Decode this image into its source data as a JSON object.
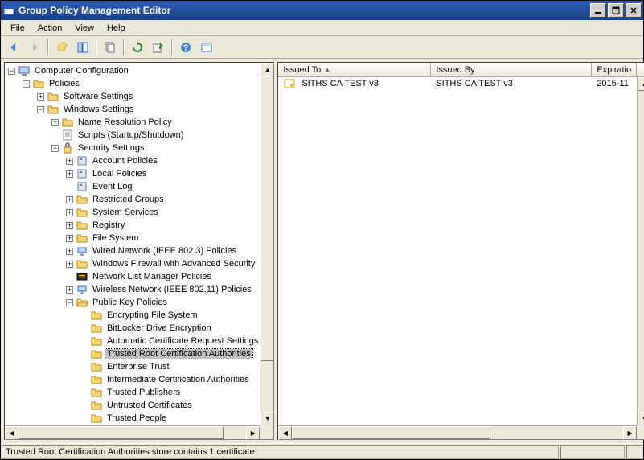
{
  "window": {
    "title": "Group Policy Management Editor"
  },
  "menu": {
    "file": "File",
    "action": "Action",
    "view": "View",
    "help": "Help"
  },
  "tree": {
    "root": "Computer Configuration",
    "policies": "Policies",
    "software": "Software Settings",
    "windows": "Windows Settings",
    "nrp": "Name Resolution Policy",
    "scripts": "Scripts (Startup/Shutdown)",
    "security": "Security Settings",
    "account": "Account Policies",
    "local": "Local Policies",
    "eventlog": "Event Log",
    "restricted": "Restricted Groups",
    "services": "System Services",
    "registry": "Registry",
    "filesystem": "File System",
    "wired": "Wired Network (IEEE 802.3) Policies",
    "wfas": "Windows Firewall with Advanced Security",
    "nlm": "Network List Manager Policies",
    "wireless": "Wireless Network (IEEE 802.11) Policies",
    "pkp": "Public Key Policies",
    "efs": "Encrypting File System",
    "bitlocker": "BitLocker Drive Encryption",
    "acrs": "Automatic Certificate Request Settings",
    "trca": "Trusted Root Certification Authorities",
    "et": "Enterprise Trust",
    "ica": "Intermediate Certification Authorities",
    "tp": "Trusted Publishers",
    "uc": "Untrusted Certificates",
    "tpeople": "Trusted People"
  },
  "list": {
    "columns": {
      "issuedTo": "Issued To",
      "issuedBy": "Issued By",
      "expiration": "Expiratio"
    },
    "rows": [
      {
        "issuedTo": "SITHS CA TEST v3",
        "issuedBy": "SITHS CA TEST v3",
        "expiration": "2015-11"
      }
    ]
  },
  "status": {
    "text": "Trusted Root Certification Authorities store contains 1 certificate."
  }
}
